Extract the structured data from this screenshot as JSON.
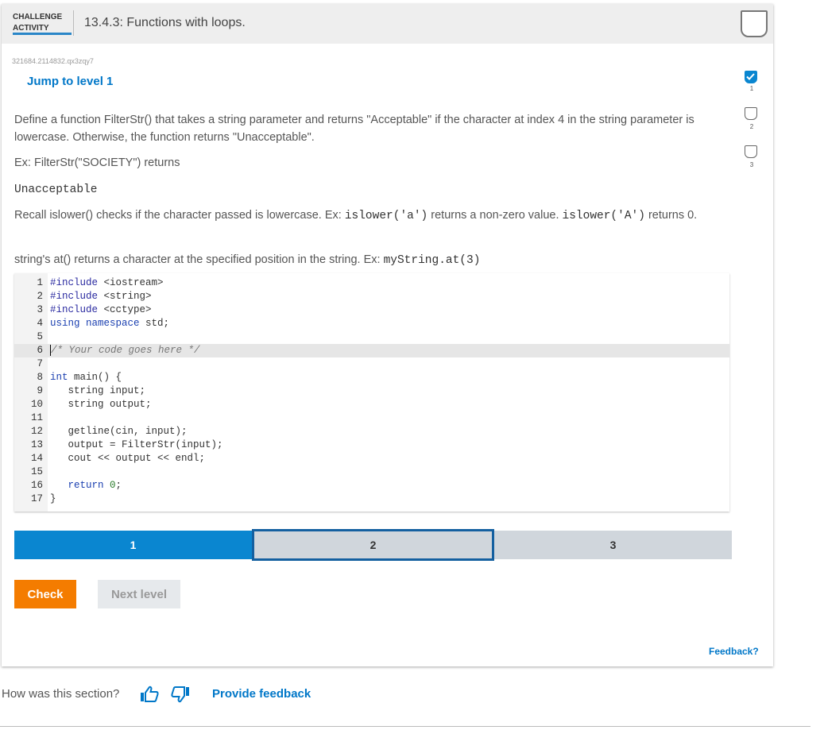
{
  "header": {
    "badge_line1": "CHALLENGE",
    "badge_line2": "ACTIVITY",
    "title": "13.4.3: Functions with loops."
  },
  "activity_id": "321684.2114832.qx3zqy7",
  "jump_label": "Jump to level 1",
  "prompt": {
    "p1": "Define a function FilterStr() that takes a string parameter and returns \"Acceptable\" if the character at index 4 in the string parameter is lowercase. Otherwise, the function returns \"Unacceptable\".",
    "p2": "Ex: FilterStr(\"SOCIETY\") returns",
    "p3_mono": "Unacceptable",
    "p4_a": "Recall islower() checks if the character passed is lowercase. Ex: ",
    "p4_code1": "islower('a')",
    "p4_b": " returns a non-zero value. ",
    "p4_code2": "islower('A')",
    "p4_c": " returns 0.",
    "p5_a": "string's at() returns a character at the specified position in the string. Ex: ",
    "p5_code": "myString.at(3)"
  },
  "code": {
    "line_numbers": [
      "1",
      "2",
      "3",
      "4",
      "5",
      "6",
      "7",
      "8",
      "9",
      "10",
      "11",
      "12",
      "13",
      "14",
      "15",
      "16",
      "17"
    ],
    "l1_pp": "#include",
    "l1_rest": " <iostream>",
    "l2_pp": "#include",
    "l2_rest": " <string>",
    "l3_pp": "#include",
    "l3_rest": " <cctype>",
    "l4_kw1": "using",
    "l4_kw2": " namespace",
    "l4_rest": " std;",
    "l6_comment": "/* Your code goes here */",
    "l8_kw": "int",
    "l8_rest": " main() {",
    "l9": "   string input;",
    "l10": "   string output;",
    "l12": "   getline(cin, input);",
    "l13": "   output = FilterStr(input);",
    "l14": "   cout << output << endl;",
    "l16_kw": "   return",
    "l16_num": " 0",
    "l16_end": ";",
    "l17": "}"
  },
  "levels": [
    "1",
    "2",
    "3"
  ],
  "buttons": {
    "check": "Check",
    "next": "Next level"
  },
  "side_levels": [
    "1",
    "2",
    "3"
  ],
  "feedback_link": "Feedback?",
  "bottom": {
    "question": "How was this section?",
    "provide": "Provide feedback"
  },
  "colors": {
    "accent": "#0077c8",
    "check_button": "#f47c00",
    "level_active": "#0a86d0"
  }
}
